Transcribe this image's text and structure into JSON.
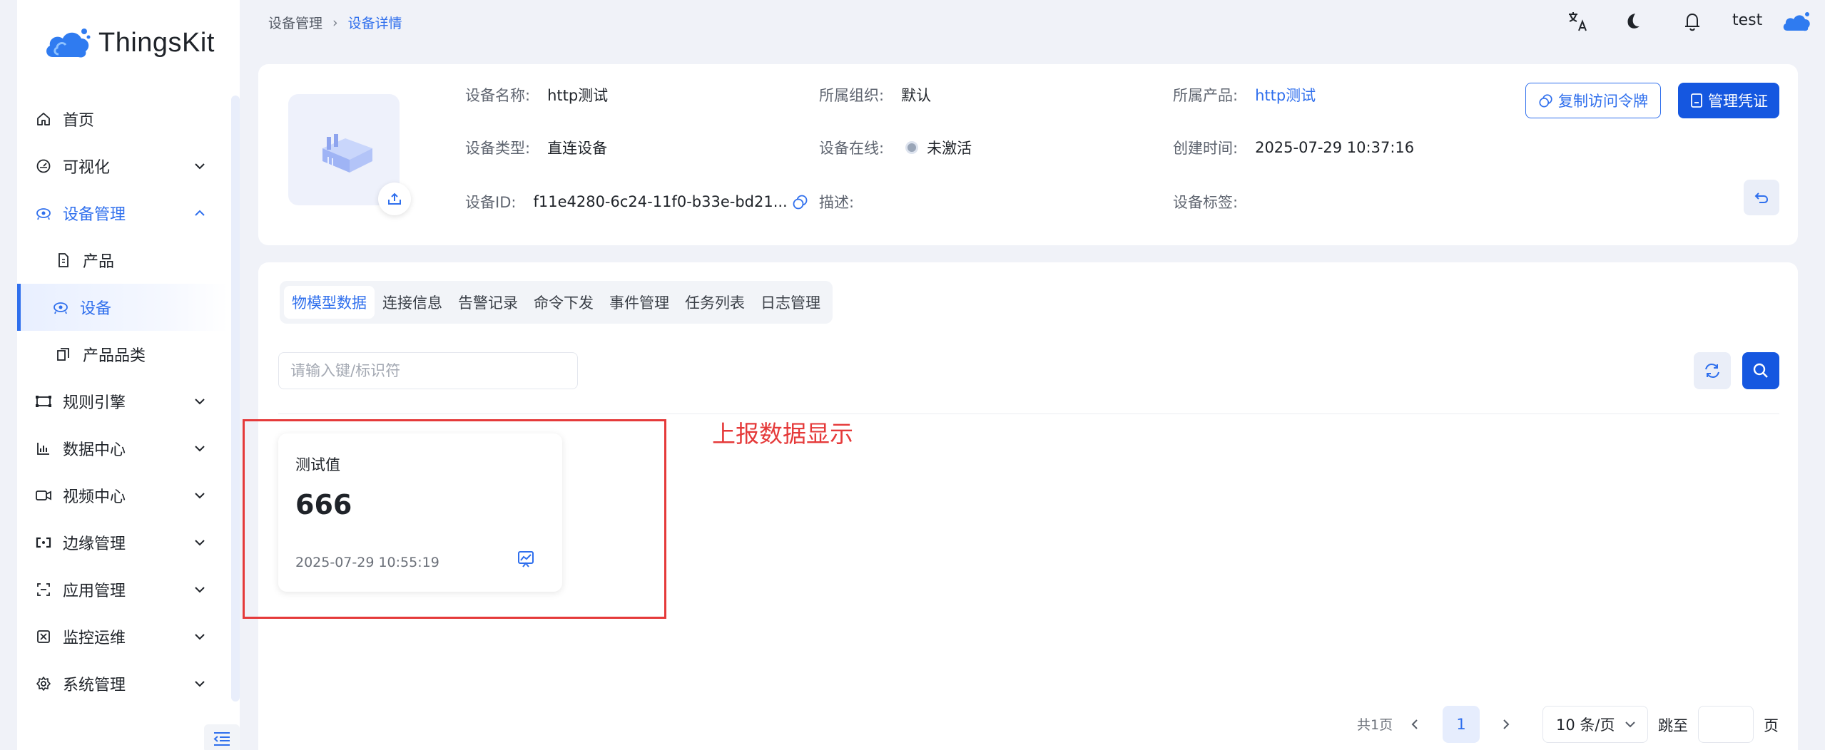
{
  "app": {
    "name": "ThingsKit"
  },
  "sidebar": {
    "items": [
      {
        "label": "首页",
        "icon": "home-icon"
      },
      {
        "label": "可视化",
        "icon": "dashboard-icon"
      },
      {
        "label": "设备管理",
        "icon": "device-icon"
      },
      {
        "label": "产品",
        "icon": "product-icon"
      },
      {
        "label": "设备",
        "icon": "device-icon"
      },
      {
        "label": "产品品类",
        "icon": "category-icon"
      },
      {
        "label": "规则引擎",
        "icon": "rule-icon"
      },
      {
        "label": "数据中心",
        "icon": "data-icon"
      },
      {
        "label": "视频中心",
        "icon": "video-icon"
      },
      {
        "label": "边缘管理",
        "icon": "edge-icon"
      },
      {
        "label": "应用管理",
        "icon": "app-icon"
      },
      {
        "label": "监控运维",
        "icon": "monitor-icon"
      },
      {
        "label": "系统管理",
        "icon": "settings-icon"
      }
    ]
  },
  "header": {
    "breadcrumb": [
      "设备管理",
      "设备详情"
    ],
    "username": "test"
  },
  "device": {
    "name_label": "设备名称:",
    "name": "http测试",
    "org_label": "所属组织:",
    "org": "默认",
    "product_label": "所属产品:",
    "product": "http测试",
    "type_label": "设备类型:",
    "type": "直连设备",
    "online_label": "设备在线:",
    "online": "未激活",
    "created_label": "创建时间:",
    "created": "2025-07-29 10:37:16",
    "id_label": "设备ID:",
    "id": "f11e4280-6c24-11f0-b33e-bd21...",
    "desc_label": "描述:",
    "desc": "",
    "tags_label": "设备标签:",
    "tags": "",
    "copy_token_label": "复制访问令牌",
    "manage_cred_label": "管理凭证"
  },
  "tabs": [
    "物模型数据",
    "连接信息",
    "告警记录",
    "命令下发",
    "事件管理",
    "任务列表",
    "日志管理"
  ],
  "search": {
    "placeholder": "请输入键/标识符"
  },
  "cards": [
    {
      "name": "测试值",
      "value": "666",
      "time": "2025-07-29 10:55:19"
    }
  ],
  "annotation": "上报数据显示",
  "pagination": {
    "total": "共1页",
    "current": "1",
    "page_size": "10 条/页",
    "jump_label": "跳至",
    "page_label": "页"
  },
  "colors": {
    "primary": "#1557e0",
    "accent": "#2f6fed",
    "annotation": "#e53a3a"
  }
}
